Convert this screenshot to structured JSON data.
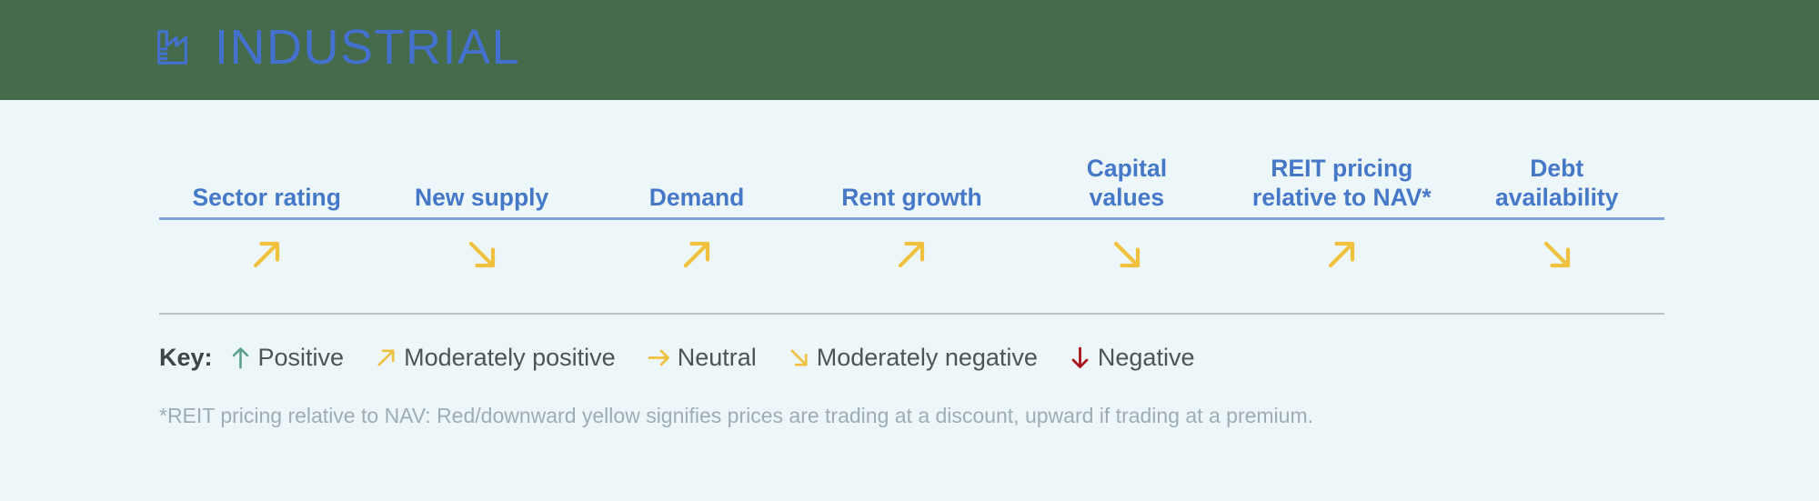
{
  "header": {
    "icon": "factory-icon",
    "title": "INDUSTRIAL",
    "band_color": "#456b4b",
    "title_color": "#4470ce"
  },
  "colors": {
    "page_background": "#edf7fa",
    "header_text": "#4678c8",
    "header_rule": "#7ba3dd",
    "section_rule": "#b9c3c7",
    "positive": "#5aa08a",
    "moderate": "#efc13f",
    "negative": "#a81419",
    "key_label": "#3d4548",
    "key_text": "#4b5457",
    "footnote": "#9fadb3"
  },
  "table": {
    "columns": [
      {
        "label": "Sector rating",
        "rating": "moderately-positive",
        "arrow": "up-right"
      },
      {
        "label": "New supply",
        "rating": "moderately-negative",
        "arrow": "down-right"
      },
      {
        "label": "Demand",
        "rating": "moderately-positive",
        "arrow": "up-right"
      },
      {
        "label": "Rent growth",
        "rating": "moderately-positive",
        "arrow": "up-right"
      },
      {
        "label": "Capital\nvalues",
        "rating": "moderately-negative",
        "arrow": "down-right"
      },
      {
        "label": "REIT pricing\nrelative to NAV*",
        "rating": "moderately-positive",
        "arrow": "up-right"
      },
      {
        "label": "Debt\navailability",
        "rating": "moderately-negative",
        "arrow": "down-right"
      }
    ]
  },
  "key": {
    "label": "Key:",
    "items": [
      {
        "text": "Positive",
        "arrow": "up",
        "color": "#5aa08a"
      },
      {
        "text": "Moderately positive",
        "arrow": "up-right",
        "color": "#efc13f"
      },
      {
        "text": "Neutral",
        "arrow": "right",
        "color": "#efc13f"
      },
      {
        "text": "Moderately negative",
        "arrow": "down-right",
        "color": "#efc13f"
      },
      {
        "text": "Negative",
        "arrow": "down",
        "color": "#a81419"
      }
    ]
  },
  "footnote": "*REIT pricing relative to NAV: Red/downward yellow signifies prices are trading at a discount, upward if trading at a premium."
}
